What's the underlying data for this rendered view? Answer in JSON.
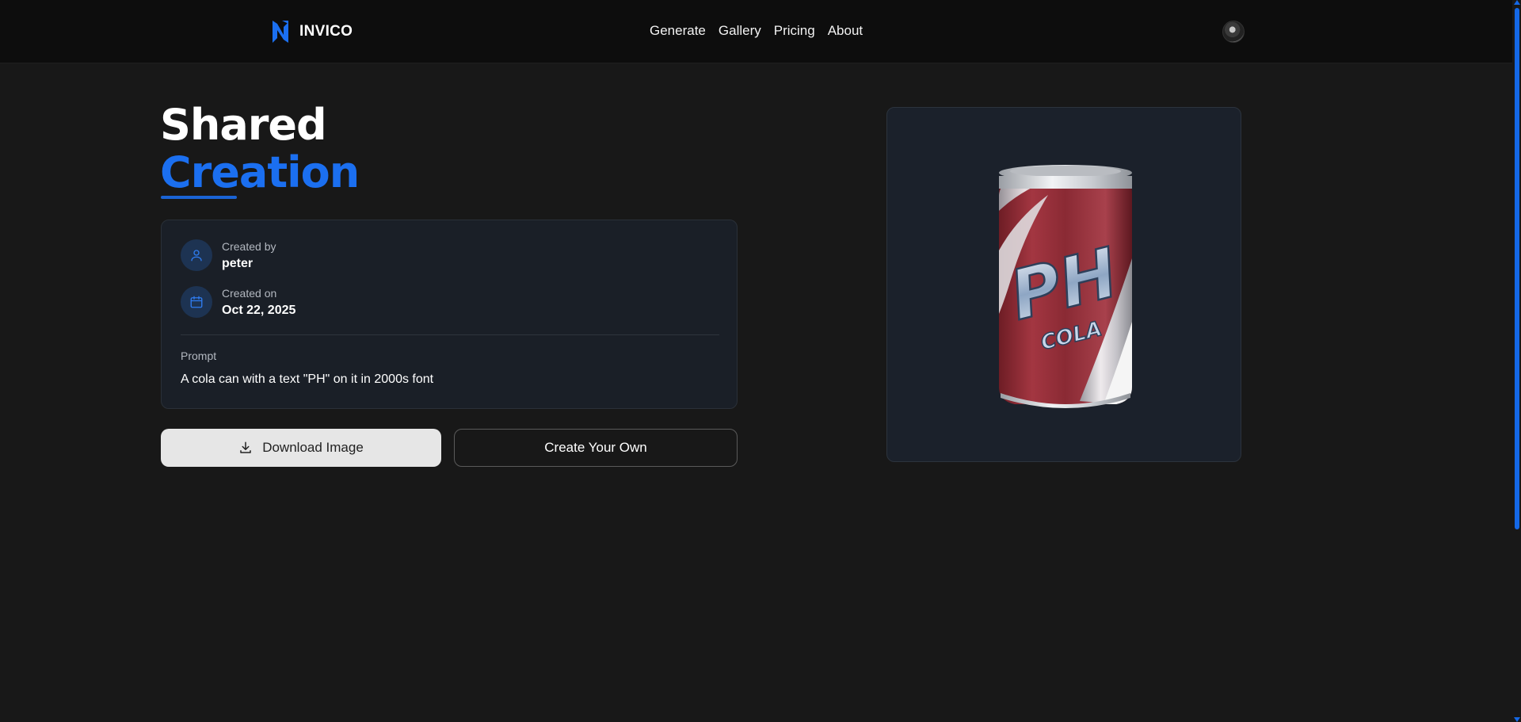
{
  "header": {
    "brand_name": "INVICO",
    "nav": [
      "Generate",
      "Gallery",
      "Pricing",
      "About"
    ]
  },
  "page": {
    "title_line1": "Shared",
    "title_line2": "Creation"
  },
  "details": {
    "created_by_label": "Created by",
    "created_by_value": "peter",
    "created_on_label": "Created on",
    "created_on_value": "Oct 22, 2025",
    "prompt_label": "Prompt",
    "prompt_text": "A cola can with a text \"PH\" on it in 2000s font"
  },
  "actions": {
    "download_label": "Download Image",
    "create_label": "Create Your Own"
  },
  "image": {
    "can_text_main": "PH",
    "can_text_sub": "COLA"
  },
  "colors": {
    "accent": "#1b6ff0",
    "background": "#181818",
    "card": "#1a1f27"
  }
}
